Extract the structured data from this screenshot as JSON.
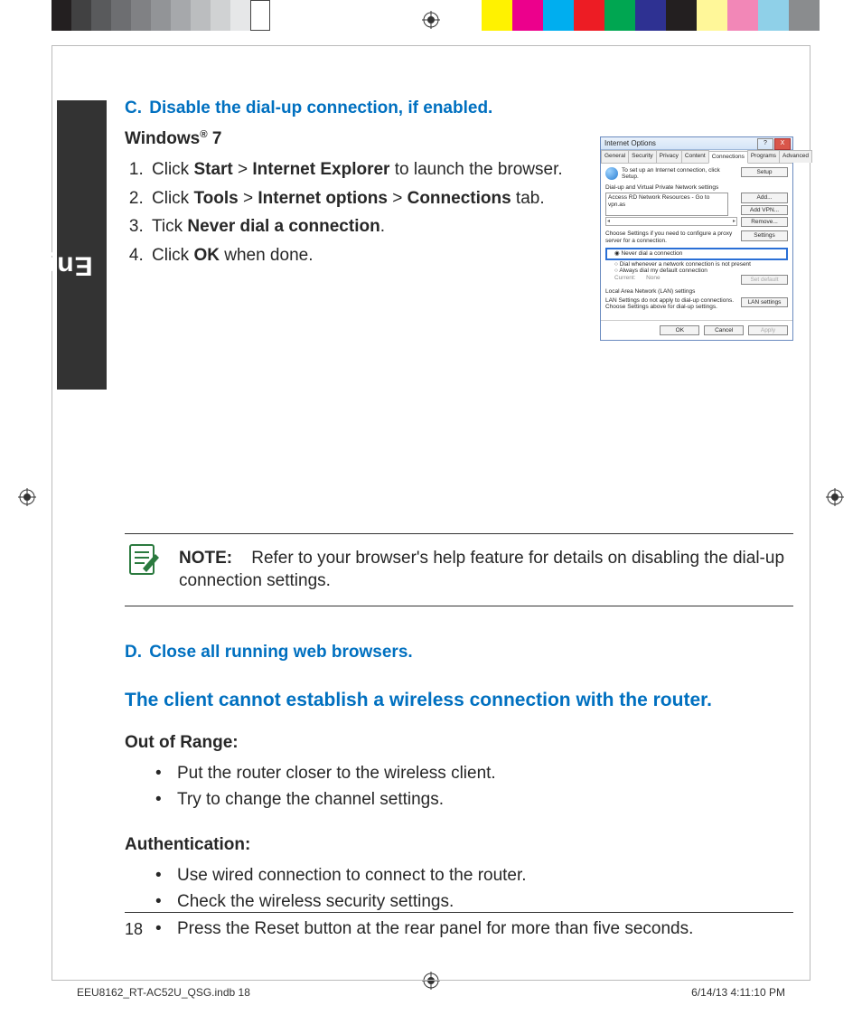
{
  "language_tab": "English",
  "section_c": {
    "label": "C.",
    "title": "Disable the dial-up connection, if enabled."
  },
  "os_heading_prefix": "Windows",
  "os_heading_suffix": " 7",
  "steps": {
    "s1_a": "Click ",
    "s1_b": "Start",
    "s1_c": " > ",
    "s1_d": "Internet Explorer",
    "s1_e": " to launch the browser.",
    "s2_a": "Click ",
    "s2_b": "Tools",
    "s2_c": " > ",
    "s2_d": "Internet options",
    "s2_e": " > ",
    "s2_f": "Connections",
    "s2_g": " tab.",
    "s3_a": "Tick ",
    "s3_b": "Never dial a connection",
    "s3_c": ".",
    "s4_a": "Click ",
    "s4_b": "OK",
    "s4_c": " when done."
  },
  "note": {
    "label": "NOTE:",
    "text": "Refer to your browser's help feature for details on disabling the dial-up connection settings."
  },
  "section_d": {
    "label": "D.",
    "title": "Close all running web browsers."
  },
  "headline": "The client cannot establish a wireless connection with the router.",
  "out_of_range": {
    "title": "Out of Range:",
    "items": [
      "Put the router closer to the wireless client.",
      "Try to change the channel settings."
    ]
  },
  "authentication": {
    "title": "Authentication:",
    "items": [
      "Use wired connection to connect to the router.",
      "Check the wireless security settings.",
      "Press the Reset button at the rear panel for more than five seconds."
    ]
  },
  "page_number": "18",
  "footer": {
    "left": "EEU8162_RT-AC52U_QSG.indb   18",
    "right": "6/14/13   4:11:10 PM"
  },
  "dialog": {
    "title": "Internet Options",
    "tabs": [
      "General",
      "Security",
      "Privacy",
      "Content",
      "Connections",
      "Programs",
      "Advanced"
    ],
    "setup_text": "To set up an Internet connection, click Setup.",
    "setup_btn": "Setup",
    "dun_title": "Dial-up and Virtual Private Network settings",
    "dun_item": "Access RD Network Resources - Go to vpn.as",
    "btn_add": "Add...",
    "btn_addvpn": "Add VPN...",
    "btn_remove": "Remove...",
    "proxy_text": "Choose Settings if you need to configure a proxy server for a connection.",
    "btn_settings": "Settings",
    "radio_never": "Never dial a connection",
    "radio_dial": "Dial whenever a network connection is not present",
    "radio_always": "Always dial my default connection",
    "current": "Current:",
    "none": "None",
    "btn_setdef": "Set default",
    "lan_title": "Local Area Network (LAN) settings",
    "lan_text": "LAN Settings do not apply to dial-up connections. Choose Settings above for dial-up settings.",
    "btn_lan": "LAN settings",
    "btn_ok": "OK",
    "btn_cancel": "Cancel",
    "btn_apply": "Apply"
  }
}
